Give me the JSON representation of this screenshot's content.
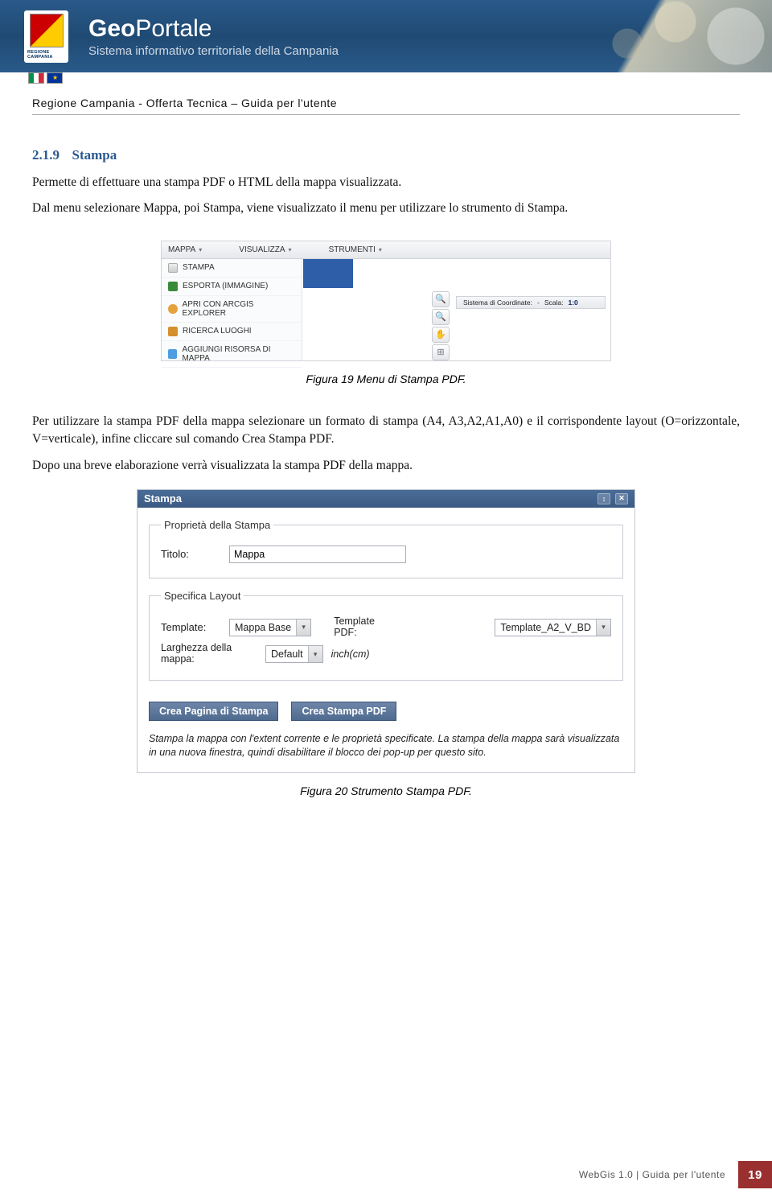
{
  "header": {
    "shield_label": "REGIONE CAMPANIA",
    "title_bold": "Geo",
    "title_light": "Portale",
    "subtitle": "Sistema informativo territoriale della Campania"
  },
  "breadcrumb": "Regione Campania - Offerta Tecnica – Guida per l'utente",
  "section": {
    "num": "2.1.9",
    "title": "Stampa"
  },
  "paragraphs": {
    "p1": "Permette di effettuare una stampa PDF o HTML della mappa visualizzata.",
    "p2": "Dal menu selezionare Mappa, poi Stampa, viene visualizzato il menu per utilizzare lo strumento di Stampa.",
    "p3": "Per utilizzare la stampa PDF della mappa selezionare un formato di stampa (A4, A3,A2,A1,A0) e il corrispondente layout (O=orizzontale, V=verticale), infine cliccare sul comando Crea Stampa PDF.",
    "p4": "Dopo una breve elaborazione verrà visualizzata la stampa PDF della mappa."
  },
  "fig19": {
    "menubar": {
      "mappa": "MAPPA",
      "visualizza": "VISUALIZZA",
      "strumenti": "STRUMENTI"
    },
    "items": {
      "stampa": "STAMPA",
      "esporta": "ESPORTA (IMMAGINE)",
      "arcgis": "APRI CON ARCGIS EXPLORER",
      "ricerca": "RICERCA LUOGHI",
      "aggiungi": "AGGIUNGI RISORSA DI MAPPA"
    },
    "status": {
      "coord_label": "Sistema di Coordinate:",
      "sep": "-",
      "scala_label": "Scala:",
      "scala_val": "1:0"
    },
    "caption": "Figura 19 Menu di Stampa PDF."
  },
  "fig20": {
    "dialog_title": "Stampa",
    "group1_legend": "Proprietà della Stampa",
    "titolo_label": "Titolo:",
    "titolo_value": "Mappa",
    "group2_legend": "Specifica Layout",
    "template_label": "Template:",
    "template_value": "Mappa Base",
    "templatepdf_label": "Template PDF:",
    "templatepdf_value": "Template_A2_V_BD",
    "larghezza_label": "Larghezza della mappa:",
    "larghezza_value": "Default",
    "larghezza_unit": "inch(cm)",
    "btn1": "Crea Pagina di Stampa",
    "btn2": "Crea Stampa PDF",
    "note": "Stampa la mappa con l'extent corrente e le proprietà specificate. La stampa della mappa sarà visualizzata in una nuova finestra, quindi disabilitare il blocco dei pop-up per questo sito.",
    "caption": "Figura 20 Strumento Stampa PDF."
  },
  "footer": {
    "text": "WebGis 1.0  |  Guida per l'utente",
    "page": "19"
  }
}
